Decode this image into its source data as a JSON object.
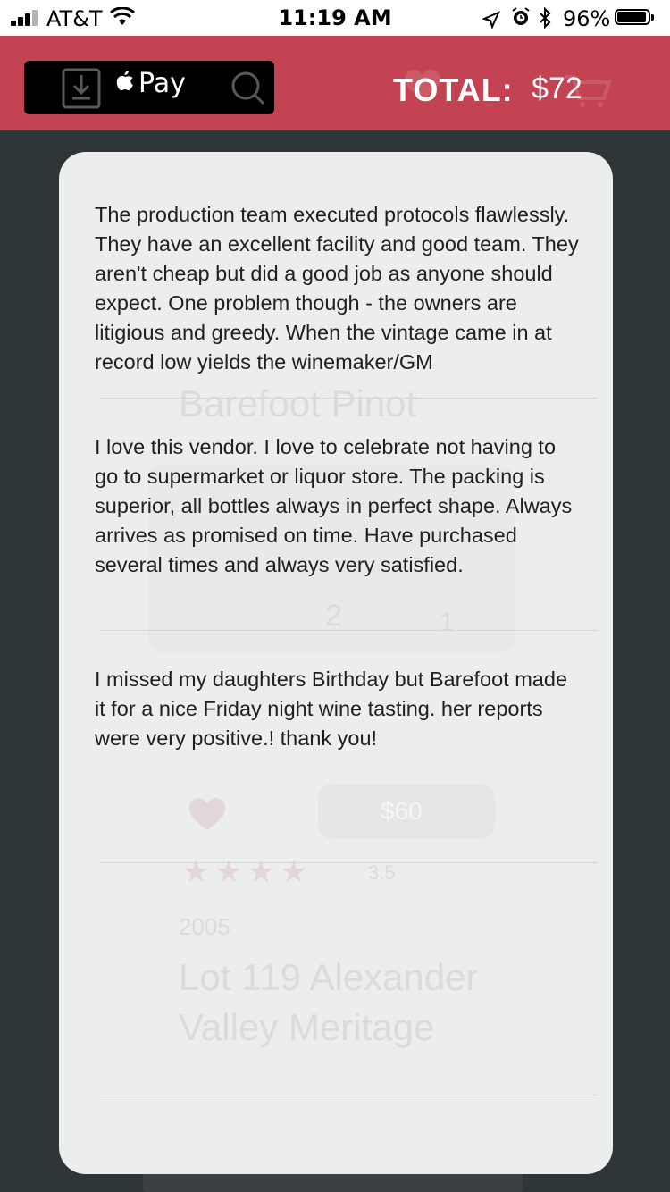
{
  "status_bar": {
    "carrier": "AT&T",
    "time": "11:19 AM",
    "battery": "96%"
  },
  "header": {
    "pay_label": "Pay",
    "total_label": "TOTAL:",
    "total_value": "$72"
  },
  "reviews": [
    {
      "text": "The production team executed protocols flawlessly. They have an excellent facility and good team. They aren't cheap but did a good job as anyone should expect. One problem though - the owners are litigious and greedy. When the vintage came in at record low yields the winemaker/GM"
    },
    {
      "text": "I love this vendor. I love to celebrate not having to go to supermarket or liquor store. The packing is superior, all bottles always in perfect shape. Always arrives as promised on time. Have purchased several times and always very satisfied."
    },
    {
      "text": "I missed my daughters Birthday but Barefoot made it for a nice Friday night wine tasting. her reports were very positive.! thank you!"
    }
  ],
  "background_product": {
    "name_1": "Barefoot Pinot",
    "qty_left": "2",
    "qty_right": "1",
    "price": "$60",
    "rating": "3.5",
    "year": "2005",
    "name_2_line1": "Lot 119 Alexander",
    "name_2_line2": "Valley Meritage"
  }
}
